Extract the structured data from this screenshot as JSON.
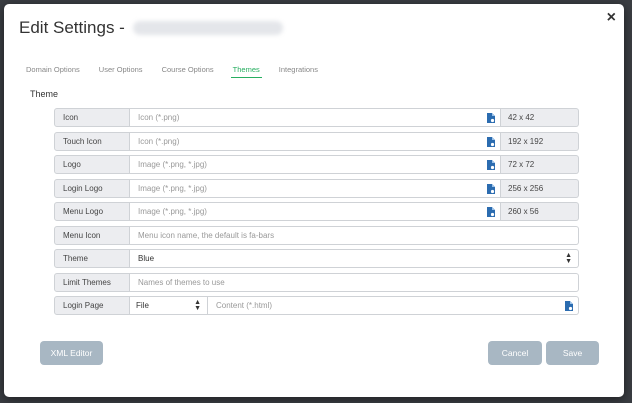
{
  "window": {
    "title": "Edit Settings -",
    "close_glyph": "×"
  },
  "tabs": [
    {
      "label": "Domain Options",
      "active": false
    },
    {
      "label": "User Options",
      "active": false
    },
    {
      "label": "Course Options",
      "active": false
    },
    {
      "label": "Themes",
      "active": true
    },
    {
      "label": "Integrations",
      "active": false
    }
  ],
  "section_label": "Theme",
  "rows": {
    "icon": {
      "label": "Icon",
      "placeholder": "Icon (*.png)",
      "size": "42 x 42"
    },
    "touch_icon": {
      "label": "Touch Icon",
      "placeholder": "Icon (*.png)",
      "size": "192 x 192"
    },
    "logo": {
      "label": "Logo",
      "placeholder": "Image (*.png, *.jpg)",
      "size": "72 x 72"
    },
    "login_logo": {
      "label": "Login Logo",
      "placeholder": "Image (*.png, *.jpg)",
      "size": "256 x 256"
    },
    "menu_logo": {
      "label": "Menu Logo",
      "placeholder": "Image (*.png, *.jpg)",
      "size": "260 x 56"
    },
    "menu_icon": {
      "label": "Menu Icon",
      "placeholder": "Menu icon name, the default is fa-bars"
    },
    "theme": {
      "label": "Theme",
      "value": "Blue"
    },
    "limit_themes": {
      "label": "Limit Themes",
      "placeholder": "Names of themes to use"
    },
    "login_page": {
      "label": "Login Page",
      "type_value": "File",
      "placeholder": "Content (*.html)"
    }
  },
  "buttons": {
    "xml_editor": "XML Editor",
    "cancel": "Cancel",
    "save": "Save"
  },
  "colors": {
    "accent": "#27ae60",
    "button": "#a8b7c3",
    "file_icon": "#2b6cb0"
  },
  "icons": {
    "file": "file-upload-icon",
    "select": "select-arrows-icon",
    "close": "close-icon"
  }
}
